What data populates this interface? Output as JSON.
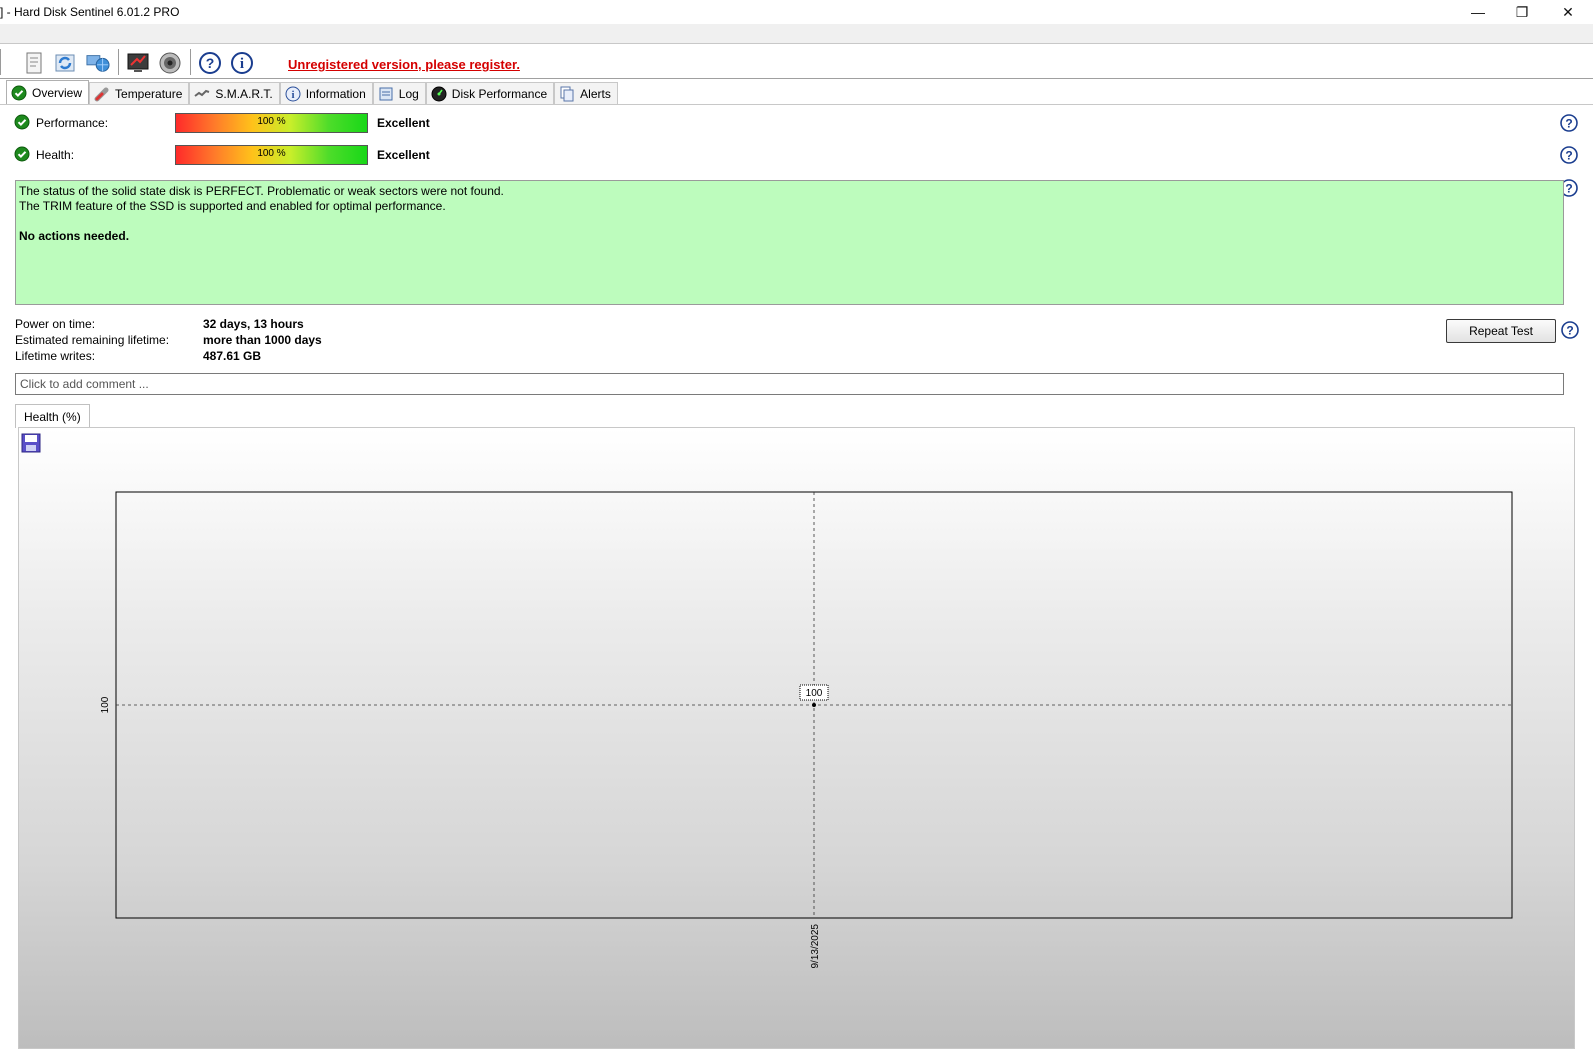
{
  "window": {
    "title": "]  -  Hard Disk Sentinel 6.01.2 PRO",
    "controls": {
      "minimize": "—",
      "restore": "❐",
      "close": "✕"
    }
  },
  "toolbar": {
    "icons": [
      "report-icon",
      "refresh-icon",
      "network-icon",
      "monitor-icon",
      "speaker-icon",
      "help-icon",
      "info-icon"
    ],
    "register_text": "Unregistered version, please register."
  },
  "tabs": [
    {
      "label": "Overview",
      "icon": "check-circle-icon",
      "active": true
    },
    {
      "label": "Temperature",
      "icon": "thermometer-icon",
      "active": false
    },
    {
      "label": "S.M.A.R.T.",
      "icon": "smart-icon",
      "active": false
    },
    {
      "label": "Information",
      "icon": "info-icon",
      "active": false
    },
    {
      "label": "Log",
      "icon": "log-icon",
      "active": false
    },
    {
      "label": "Disk Performance",
      "icon": "speedometer-icon",
      "active": false
    },
    {
      "label": "Alerts",
      "icon": "alerts-icon",
      "active": false
    }
  ],
  "performance": {
    "label": "Performance:",
    "value_text": "100 %",
    "value": 100,
    "rating": "Excellent"
  },
  "health": {
    "label": "Health:",
    "value_text": "100 %",
    "value": 100,
    "rating": "Excellent"
  },
  "status": {
    "line1": "The status of the solid state disk is PERFECT. Problematic or weak sectors were not found.",
    "line2": "The TRIM feature of the SSD is supported and enabled for optimal performance.",
    "action": "No actions needed.",
    "color": "#bdfcbd"
  },
  "details": [
    {
      "label": "Power on time:",
      "value": "32 days, 13 hours"
    },
    {
      "label": "Estimated remaining lifetime:",
      "value": "more than 1000 days"
    },
    {
      "label": "Lifetime writes:",
      "value": "487.61 GB"
    }
  ],
  "repeat_test_label": "Repeat Test",
  "comment_placeholder": "Click to add comment ...",
  "chart_tab_label": "Health (%)",
  "chart_data": {
    "type": "line",
    "series": [
      {
        "x": [
          "9/13/2025"
        ],
        "values": [
          100
        ]
      }
    ],
    "y_tick": "100",
    "x_tick": "9/13/2025",
    "point_label": "100"
  }
}
